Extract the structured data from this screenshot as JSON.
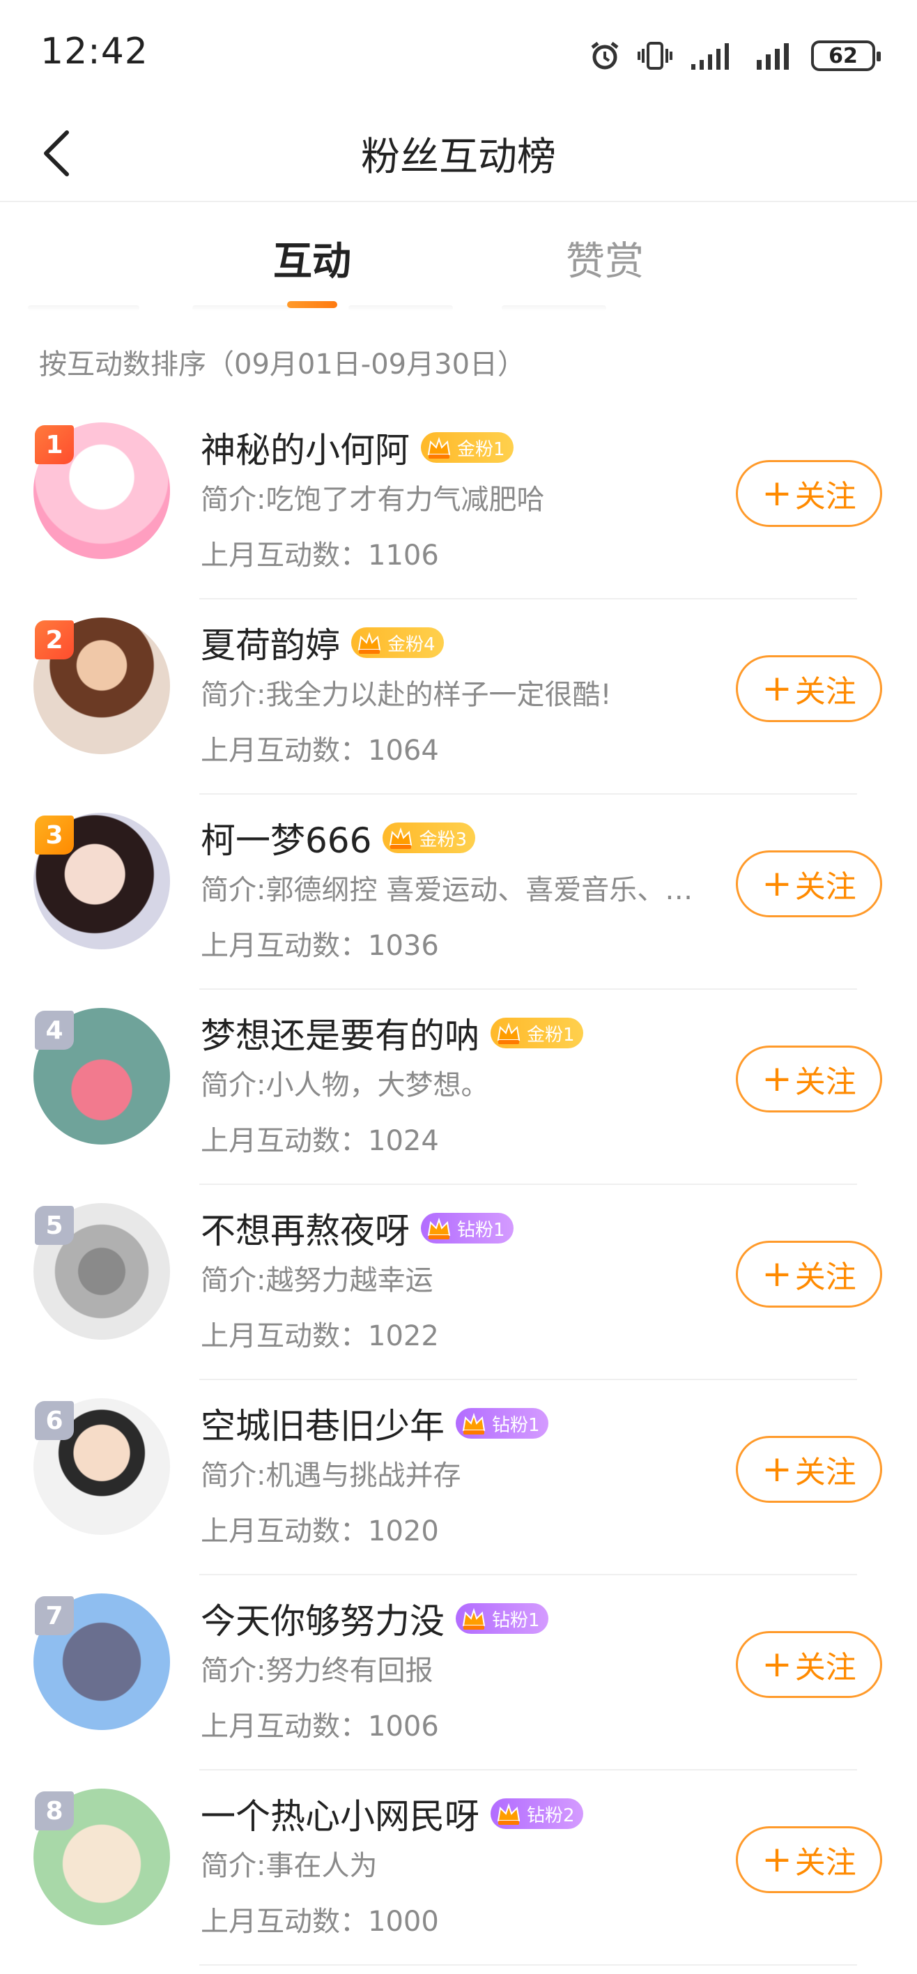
{
  "status_bar": {
    "time": "12:42",
    "battery": "62",
    "icons": [
      "alarm-icon",
      "vibrate-icon",
      "signal-icon",
      "signal-icon"
    ]
  },
  "header": {
    "title": "粉丝互动榜",
    "back_icon": "back-arrow-icon"
  },
  "tabs": [
    {
      "label": "互动",
      "active": true
    },
    {
      "label": "赞赏",
      "active": false
    }
  ],
  "sort_label": "按互动数排序（09月01日-09月30日）",
  "colors": {
    "accent": "#ff8a00",
    "gold_badge": "#ffc23a",
    "diamond_badge": "#c084ff",
    "rank_top": "#ff5a34",
    "rank_gold": "#ff9a10",
    "rank_other": "#b3b7c8"
  },
  "fans": [
    {
      "rank": "1",
      "name": "神秘的小何阿",
      "badge": "金粉1",
      "badge_type": "gold",
      "bio": "简介:吃饱了才有力气减肥哈",
      "count_label": "上月互动数：",
      "count": "1106",
      "follow": "关注",
      "rank_style": "top"
    },
    {
      "rank": "2",
      "name": "夏荷韵婷",
      "badge": "金粉4",
      "badge_type": "gold",
      "bio": "简介:我全力以赴的样子一定很酷!",
      "count_label": "上月互动数：",
      "count": "1064",
      "follow": "关注",
      "rank_style": "top"
    },
    {
      "rank": "3",
      "name": "柯一梦666",
      "badge": "金粉3",
      "badge_type": "gold",
      "bio": "简介:郭德纲控 喜爱运动、喜爱音乐、…",
      "count_label": "上月互动数：",
      "count": "1036",
      "follow": "关注",
      "rank_style": "gold"
    },
    {
      "rank": "4",
      "name": "梦想还是要有的呐",
      "badge": "金粉1",
      "badge_type": "gold",
      "bio": "简介:小人物，大梦想。",
      "count_label": "上月互动数：",
      "count": "1024",
      "follow": "关注",
      "rank_style": "other"
    },
    {
      "rank": "5",
      "name": "不想再熬夜呀",
      "badge": "钻粉1",
      "badge_type": "diamond",
      "bio": "简介:越努力越幸运",
      "count_label": "上月互动数：",
      "count": "1022",
      "follow": "关注",
      "rank_style": "other"
    },
    {
      "rank": "6",
      "name": "空城旧巷旧少年",
      "badge": "钻粉1",
      "badge_type": "diamond",
      "bio": "简介:机遇与挑战并存",
      "count_label": "上月互动数：",
      "count": "1020",
      "follow": "关注",
      "rank_style": "other"
    },
    {
      "rank": "7",
      "name": "今天你够努力没",
      "badge": "钻粉1",
      "badge_type": "diamond",
      "bio": "简介:努力终有回报",
      "count_label": "上月互动数：",
      "count": "1006",
      "follow": "关注",
      "rank_style": "other"
    },
    {
      "rank": "8",
      "name": "一个热心小网民呀",
      "badge": "钻粉2",
      "badge_type": "diamond",
      "bio": "简介:事在人为",
      "count_label": "上月互动数：",
      "count": "1000",
      "follow": "关注",
      "rank_style": "other"
    }
  ]
}
